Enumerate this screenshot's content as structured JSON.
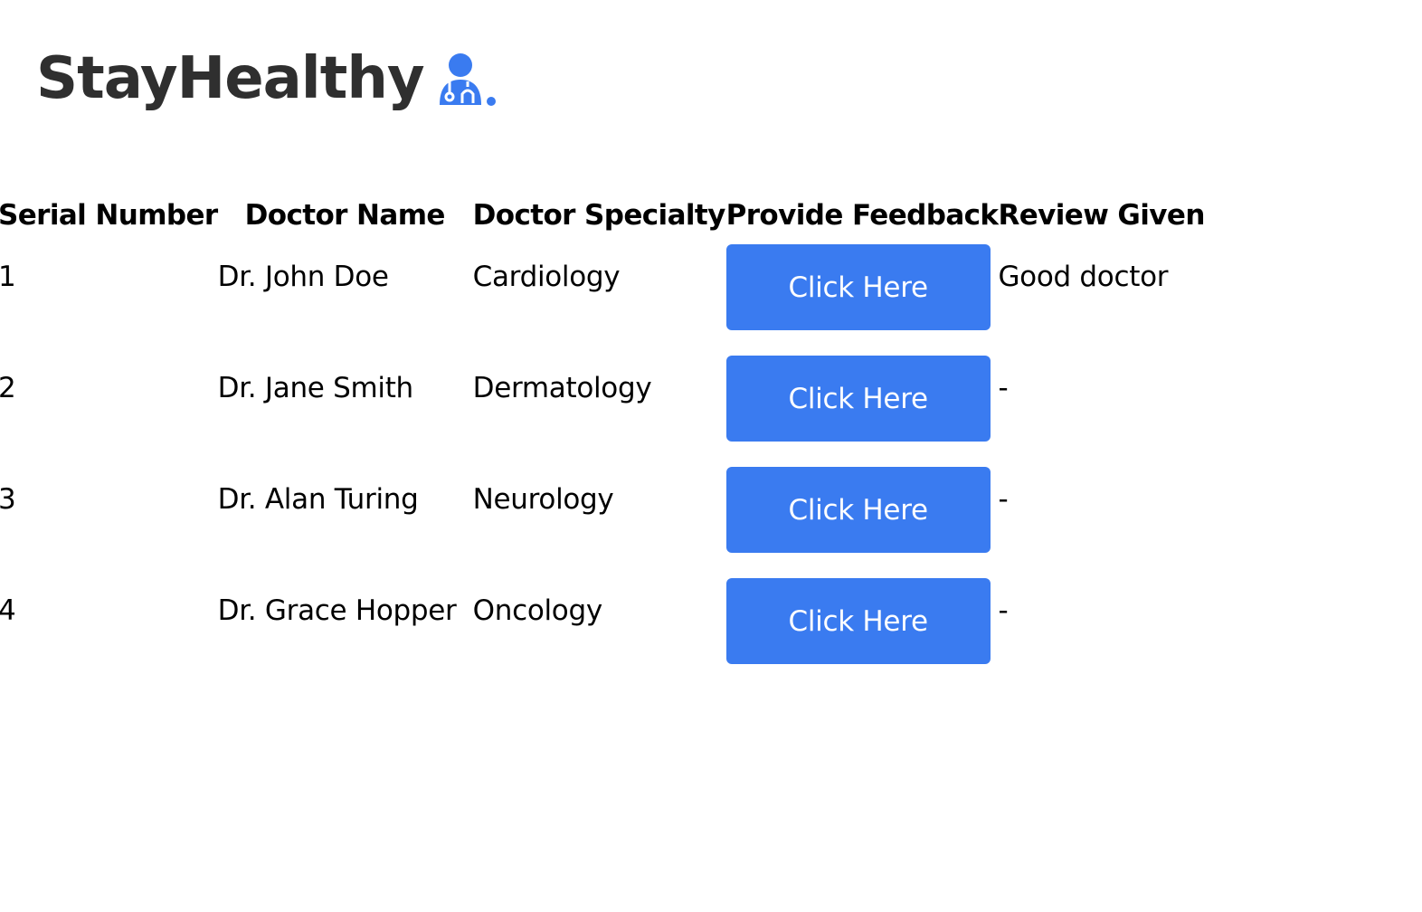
{
  "brand": {
    "name": "StayHealthy",
    "accent_color": "#3a7bf0",
    "icon": "doctor-stethoscope-icon"
  },
  "table": {
    "headers": {
      "serial": "Serial Number",
      "name": "Doctor Name",
      "specialty": "Doctor Specialty",
      "feedback": "Provide Feedback",
      "review": "Review Given"
    },
    "rows": [
      {
        "serial": "1",
        "name": "Dr. John Doe",
        "specialty": "Cardiology",
        "button": "Click Here",
        "review": "Good doctor"
      },
      {
        "serial": "2",
        "name": "Dr. Jane Smith",
        "specialty": "Dermatology",
        "button": "Click Here",
        "review": "-"
      },
      {
        "serial": "3",
        "name": "Dr. Alan Turing",
        "specialty": "Neurology",
        "button": "Click Here",
        "review": "-"
      },
      {
        "serial": "4",
        "name": "Dr. Grace Hopper",
        "specialty": "Oncology",
        "button": "Click Here",
        "review": "-"
      }
    ]
  }
}
